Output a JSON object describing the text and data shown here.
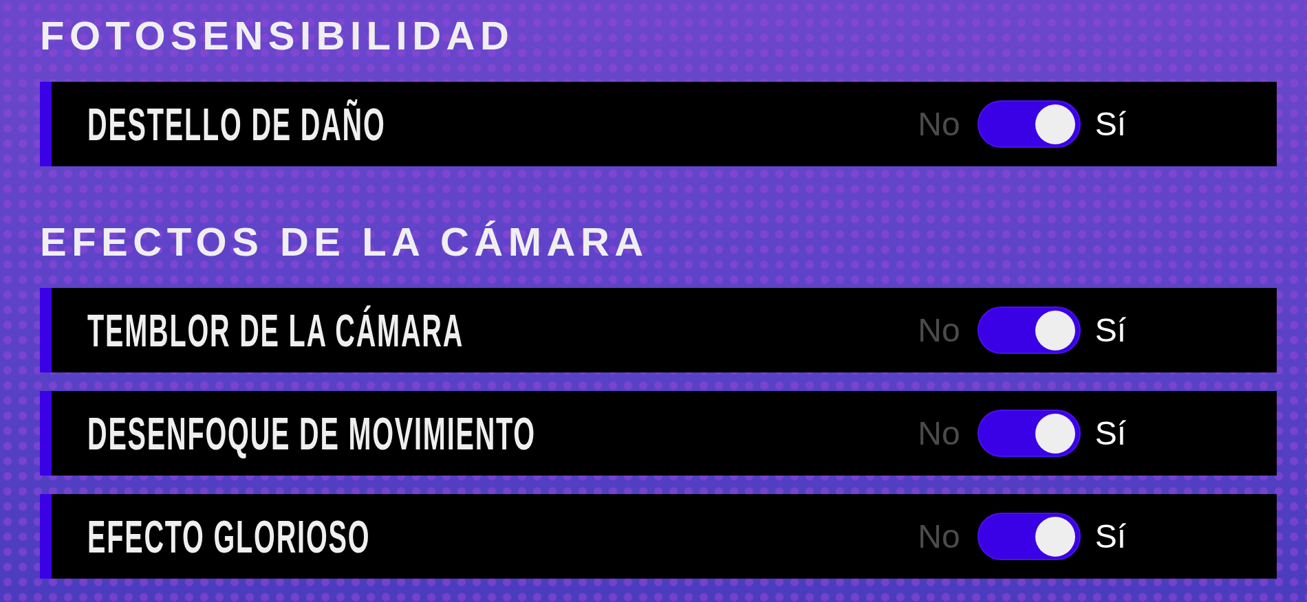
{
  "sections": [
    {
      "title": "FOTOSENSIBILIDAD",
      "settings": [
        {
          "label": "DESTELLO DE DAÑO",
          "off_label": "No",
          "on_label": "Sí",
          "on": true
        }
      ]
    },
    {
      "title": "EFECTOS DE LA CÁMARA",
      "settings": [
        {
          "label": "TEMBLOR DE LA CÁMARA",
          "off_label": "No",
          "on_label": "Sí",
          "on": true
        },
        {
          "label": "DESENFOQUE DE MOVIMIENTO",
          "off_label": "No",
          "on_label": "Sí",
          "on": true
        },
        {
          "label": "EFECTO GLORIOSO",
          "off_label": "No",
          "on_label": "Sí",
          "on": true
        }
      ]
    }
  ]
}
